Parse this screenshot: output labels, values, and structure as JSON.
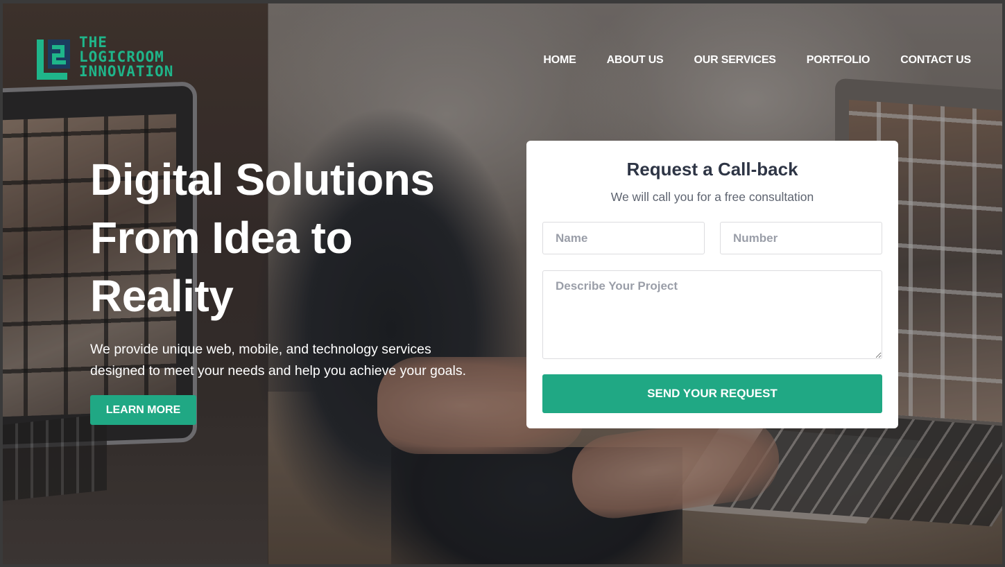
{
  "brand": {
    "logo_lines": [
      "THE",
      "LOGICROOM",
      "INNOVATION"
    ],
    "logo_color": "#1fb58a",
    "icon": "logo-mark-icon"
  },
  "nav": {
    "items": [
      {
        "label": "HOME"
      },
      {
        "label": "ABOUT US"
      },
      {
        "label": "OUR SERVICES"
      },
      {
        "label": "PORTFOLIO"
      },
      {
        "label": "CONTACT US"
      }
    ]
  },
  "hero": {
    "title_lines": [
      "Digital Solutions",
      "From Idea to",
      "Reality"
    ],
    "subtitle_lines": [
      "We provide unique web, mobile, and technology services",
      "designed to meet your needs and help you achieve your goals."
    ],
    "cta_label": "LEARN MORE"
  },
  "form": {
    "title": "Request a Call-back",
    "subtitle": "We will call you for a free consultation",
    "name_placeholder": "Name",
    "number_placeholder": "Number",
    "description_placeholder": "Describe Your Project",
    "submit_label": "SEND YOUR REQUEST"
  },
  "colors": {
    "accent": "#20a884",
    "card_title": "#2e3545",
    "text_muted": "#5e6470"
  }
}
